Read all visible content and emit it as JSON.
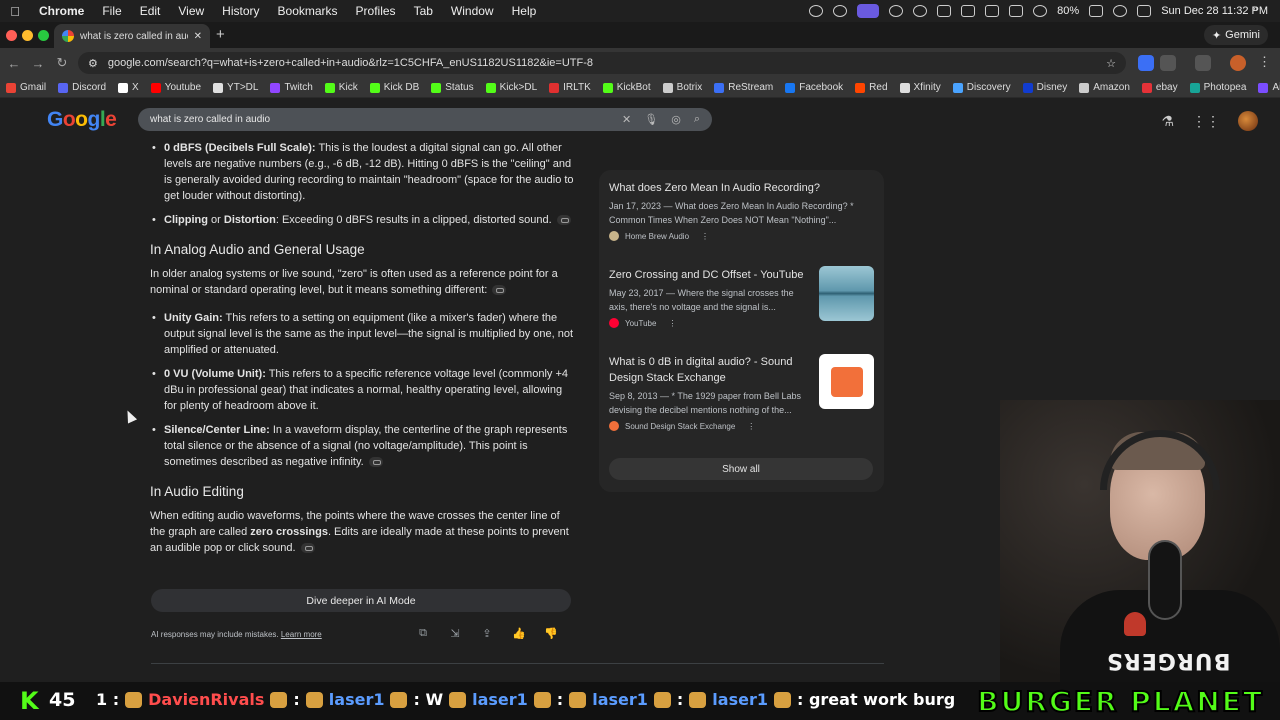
{
  "menubar": {
    "app": "Chrome",
    "items": [
      "File",
      "Edit",
      "View",
      "History",
      "Bookmarks",
      "Profiles",
      "Tab",
      "Window",
      "Help"
    ],
    "battery": "80%",
    "clock": "Sun Dec 28  11:32 PM"
  },
  "tab": {
    "title": "what is zero called in audio -"
  },
  "gemini_button": "Gemini",
  "address": {
    "url": "google.com/search?q=what+is+zero+called+in+audio&rlz=1C5CHFA_enUS1182US1182&ie=UTF-8"
  },
  "bookmarks": [
    {
      "label": "Gmail",
      "color": "#ea4335"
    },
    {
      "label": "Discord",
      "color": "#5865f2"
    },
    {
      "label": "X",
      "color": "#ffffff"
    },
    {
      "label": "Youtube",
      "color": "#ff0000"
    },
    {
      "label": "YT>DL",
      "color": "#e0e0e0"
    },
    {
      "label": "Twitch",
      "color": "#9146ff"
    },
    {
      "label": "Kick",
      "color": "#53fc18"
    },
    {
      "label": "Kick DB",
      "color": "#53fc18"
    },
    {
      "label": "Status",
      "color": "#53fc18"
    },
    {
      "label": "Kick>DL",
      "color": "#53fc18"
    },
    {
      "label": "IRLTK",
      "color": "#e03030"
    },
    {
      "label": "KickBot",
      "color": "#53fc18"
    },
    {
      "label": "Botrix",
      "color": "#cccccc"
    },
    {
      "label": "ReStream",
      "color": "#3b6ff5"
    },
    {
      "label": "Facebook",
      "color": "#1877f2"
    },
    {
      "label": "Red",
      "color": "#ff4500"
    },
    {
      "label": "Xfinity",
      "color": "#dddddd"
    },
    {
      "label": "Discovery",
      "color": "#4aa3ff"
    },
    {
      "label": "Disney",
      "color": "#113ccf"
    },
    {
      "label": "Amazon",
      "color": "#cccccc"
    },
    {
      "label": "ebay",
      "color": "#e53238"
    },
    {
      "label": "Photopea",
      "color": "#18a497"
    },
    {
      "label": "Ai Upscaler",
      "color": "#7b4dff"
    }
  ],
  "logo_letters": [
    "G",
    "o",
    "o",
    "g",
    "l",
    "e"
  ],
  "search": {
    "query": "what is zero called in audio"
  },
  "answer": {
    "b1_bold": "0 dBFS (Decibels Full Scale):",
    "b1_text": " This is the loudest a digital signal can go. All other levels are negative numbers (e.g., -6 dB, -12 dB). Hitting 0 dBFS is the \"ceiling\" and is generally avoided during recording to maintain \"headroom\" (space for the audio to get louder without distorting).",
    "b2_bold1": "Clipping",
    "b2_or": " or ",
    "b2_bold2": "Distortion",
    "b2_text": ": Exceeding 0 dBFS results in a clipped, distorted sound.",
    "h_analog": "In Analog Audio and General Usage",
    "p_analog": "In older analog systems or live sound, \"zero\" is often used as a reference point for a nominal or standard operating level, but it means something different:",
    "b3_bold": "Unity Gain:",
    "b3_text": " This refers to a setting on equipment (like a mixer's fader) where the output signal level is the same as the input level—the signal is multiplied by one, not amplified or attenuated.",
    "b4_bold": "0 VU (Volume Unit):",
    "b4_text": " This refers to a specific reference voltage level (commonly +4 dBu in professional gear) that indicates a normal, healthy operating level, allowing for plenty of headroom above it.",
    "b5_bold": "Silence/Center Line:",
    "b5_text": " In a waveform display, the centerline of the graph represents total silence or the absence of a signal (no voltage/amplitude). This point is sometimes described as negative infinity.",
    "h_editing": "In Audio Editing",
    "p_edit_1": "When editing audio waveforms, the points where the wave crosses the center line of the graph are called ",
    "p_edit_bold": "zero crossings",
    "p_edit_2": ". Edits are ideally made at these points to prevent an audible pop or click sound."
  },
  "dive_button": "Dive deeper in AI Mode",
  "disclaimer": "AI responses may include mistakes.",
  "learn_more": "Learn more",
  "sources": [
    {
      "title": "What does Zero Mean In Audio Recording?",
      "snippet": "Jan 17, 2023 — What does Zero Mean In Audio Recording? * Common Times When Zero Does NOT Mean \"Nothing\"...",
      "site": "Home Brew Audio",
      "fav_color": "#c8b48a"
    },
    {
      "title": "Zero Crossing and DC Offset - YouTube",
      "snippet": "May 23, 2017 — Where the signal crosses the axis, there's no voltage and the signal is...",
      "site": "YouTube",
      "fav_color": "#ff0033"
    },
    {
      "title": "What is 0 dB in digital audio? - Sound Design Stack Exchange",
      "snippet": "Sep 8, 2013 — * The 1929 paper from Bell Labs devising the decibel mentions nothing of the...",
      "site": "Sound Design Stack Exchange",
      "fav_color": "#f2703a"
    }
  ],
  "show_all": "Show all",
  "overlay": {
    "viewer_count": "45",
    "chat": [
      {
        "user": "1 :",
        "cls": "msg"
      },
      {
        "user": "DavienRivals",
        "cls": "usr"
      },
      {
        "user": ":",
        "cls": "msg"
      },
      {
        "user": "laser1",
        "cls": "usr2"
      },
      {
        "user": ": W",
        "cls": "msg"
      },
      {
        "user": "laser1",
        "cls": "usr2"
      },
      {
        "user": ":",
        "cls": "msg"
      },
      {
        "user": "laser1",
        "cls": "usr2"
      },
      {
        "user": ":",
        "cls": "msg"
      },
      {
        "user": "laser1",
        "cls": "usr2"
      },
      {
        "user": ": great work burg",
        "cls": "msg"
      }
    ],
    "brand": "BURGER PLANET",
    "shirt_text": "BURGERS"
  }
}
